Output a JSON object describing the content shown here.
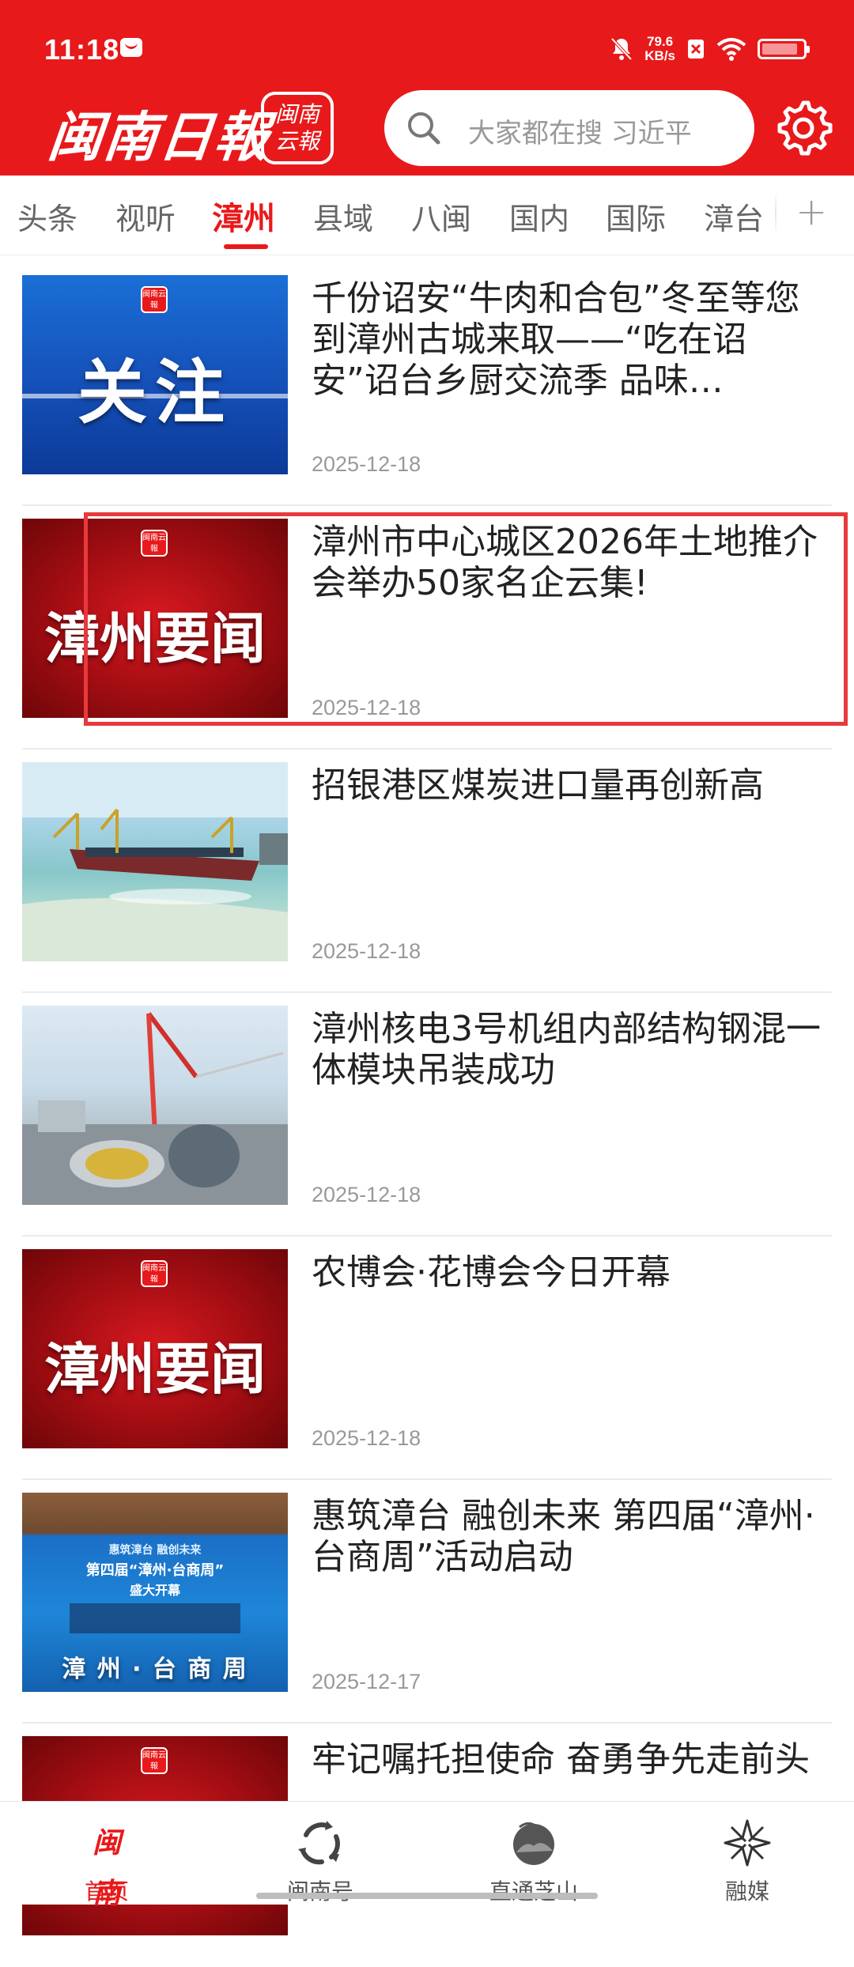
{
  "status_bar": {
    "time": "11:18",
    "net_speed_value": "79.6",
    "net_speed_unit": "KB/s"
  },
  "header": {
    "logo_text": "闽南日報",
    "logo_box_line1": "闽南",
    "logo_box_line2": "云報",
    "search_placeholder": "大家都在搜 习近平",
    "brand_color": "#e8191b"
  },
  "tabs": [
    "头条",
    "视听",
    "漳州",
    "县域",
    "八闽",
    "国内",
    "国际",
    "漳台"
  ],
  "active_tab": "漳州",
  "tab_more": "+",
  "news": [
    {
      "title": "千份诏安“牛肉和合包”冬至等您到漳州古城来取——“吃在诏安”诏台乡厨交流季 品味…",
      "date": "2025-12-18",
      "thumb_text": "关注",
      "thumb_logo": "闽南云報"
    },
    {
      "title": "漳州市中心城区2026年土地推介会举办50家名企云集!",
      "date": "2025-12-18",
      "thumb_text": "漳州要闻",
      "thumb_logo": "闽南云報"
    },
    {
      "title": "招银港区煤炭进口量再创新高",
      "date": "2025-12-18"
    },
    {
      "title": "漳州核电3号机组内部结构钢混一体模块吊装成功",
      "date": "2025-12-18"
    },
    {
      "title": "农博会·花博会今日开幕",
      "date": "2025-12-18",
      "thumb_text": "漳州要闻",
      "thumb_logo": "闽南云報"
    },
    {
      "title": "惠筑漳台 融创未来 第四届“漳州·台商周”活动启动",
      "date": "2025-12-17",
      "thumb_banner_top": "惠筑漳台 融创未来",
      "thumb_banner_mid": "第四届“漳州·台商周”",
      "thumb_banner_sub": "盛大开幕",
      "thumb_bottom": "漳 州 · 台 商 周"
    },
    {
      "title": "牢记嘱托担使命 奋勇争先走前头",
      "date": "",
      "thumb_logo": "闽南云報"
    }
  ],
  "bottom_nav": [
    {
      "label": "首页",
      "icon": "minnan-logo-icon"
    },
    {
      "label": "闽南号",
      "icon": "cycle-icon"
    },
    {
      "label": "直通芝山",
      "icon": "mountain-icon"
    },
    {
      "label": "融媒",
      "icon": "star-compass-icon"
    }
  ],
  "bottom_nav_home_mark": "闽南"
}
